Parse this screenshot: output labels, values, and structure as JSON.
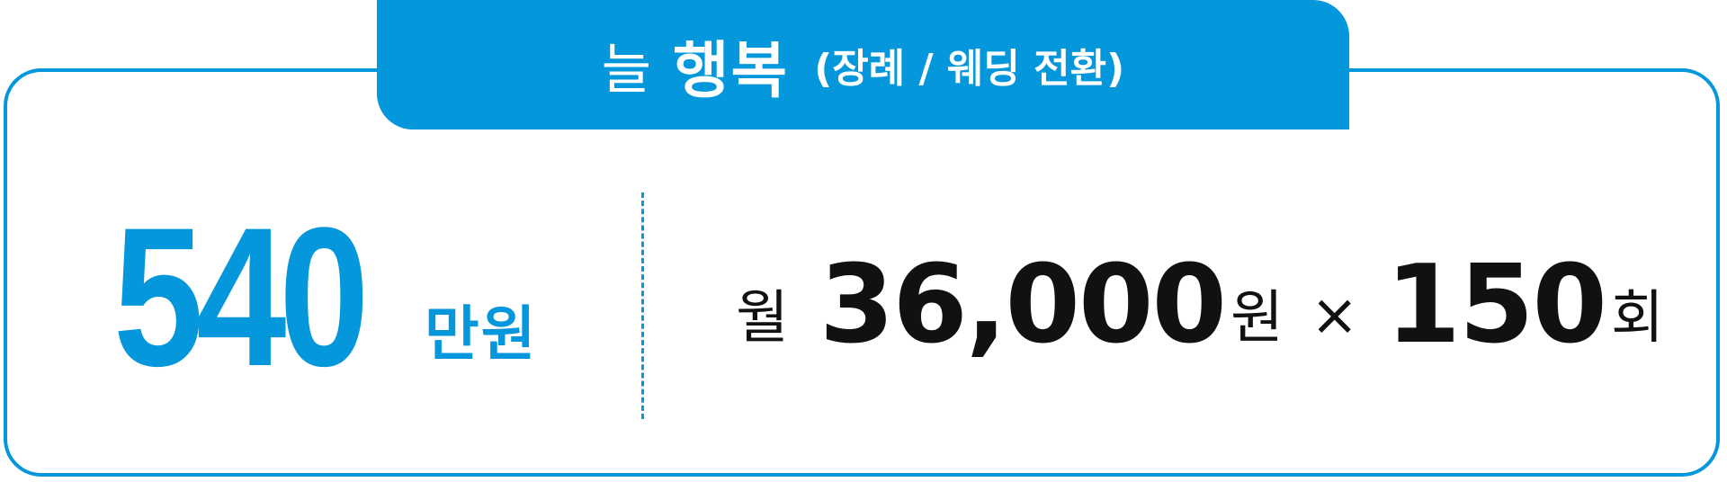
{
  "header": {
    "title_light": "늘",
    "title_bold": "행복",
    "subtitle": "(장례 / 웨딩 전환)"
  },
  "left": {
    "amount": "540",
    "unit": "만원"
  },
  "right": {
    "prefix": "월",
    "amount": "36,000",
    "amount_unit": "원",
    "operator": "×",
    "count": "150",
    "count_unit": "회"
  },
  "colors": {
    "accent": "#0597db",
    "text_dark": "#111111",
    "background": "#ffffff"
  }
}
